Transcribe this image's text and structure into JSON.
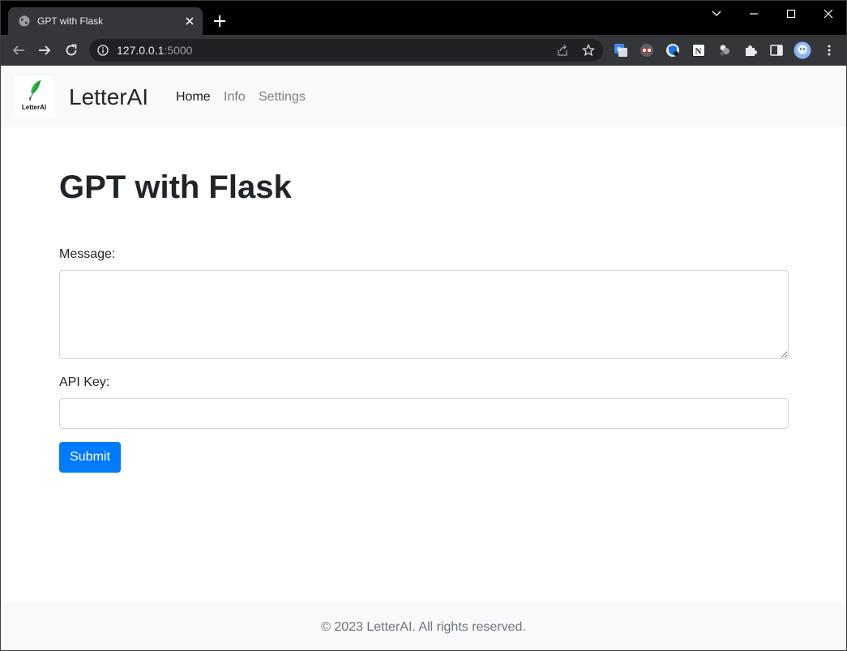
{
  "browser": {
    "tab_title": "GPT with Flask",
    "url_host": "127.0.0.1",
    "url_port": ":5000"
  },
  "icons": {
    "favicon": "globe-icon",
    "tab_close": "close-icon",
    "new_tab": "plus-icon",
    "back": "arrow-left-icon",
    "forward": "arrow-right-icon",
    "reload": "reload-icon",
    "site_info": "info-icon",
    "share": "share-icon",
    "bookmark": "star-icon",
    "extensions": [
      "translate-icon",
      "glasses-icon",
      "shield-icon",
      "notion-icon",
      "figures-icon",
      "puzzle-icon"
    ],
    "side_panel": "side-panel-icon",
    "profile": "avatar-icon",
    "menu": "more-vert-icon"
  },
  "navbar": {
    "logo_text": "LetterAI",
    "brand": "LetterAI",
    "links": [
      {
        "label": "Home",
        "active": true
      },
      {
        "label": "Info",
        "active": false
      },
      {
        "label": "Settings",
        "active": false
      }
    ]
  },
  "main": {
    "title": "GPT with Flask",
    "message_label": "Message:",
    "message_value": "",
    "api_key_label": "API Key:",
    "api_key_value": "",
    "submit_label": "Submit"
  },
  "footer": {
    "text": "© 2023 LetterAI. All rights reserved."
  },
  "colors": {
    "primary": "#007bff",
    "navbar_bg": "#f8f9fa",
    "footer_text": "#6c757d",
    "browser_dark": "#35363a"
  }
}
